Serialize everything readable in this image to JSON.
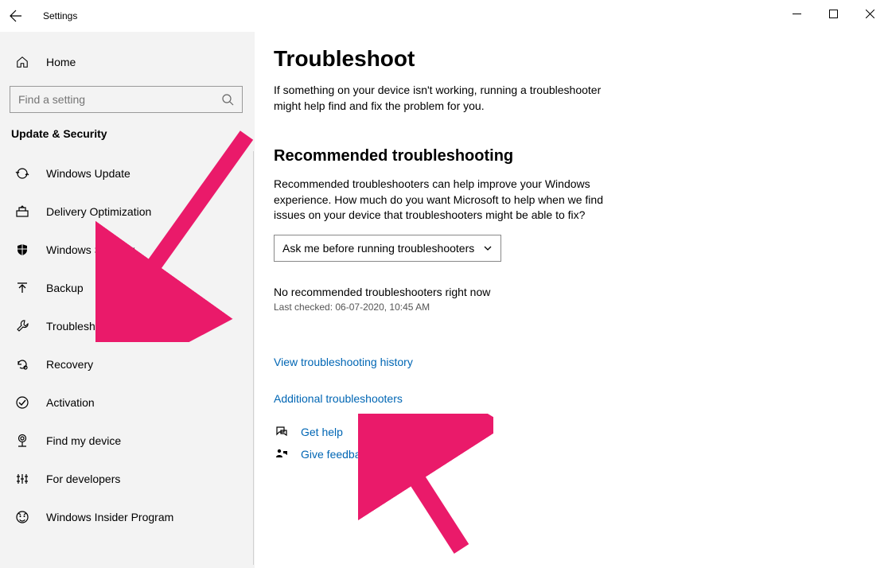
{
  "titlebar": {
    "title": "Settings"
  },
  "sidebar": {
    "home": "Home",
    "search_placeholder": "Find a setting",
    "section": "Update & Security",
    "items": [
      {
        "label": "Windows Update"
      },
      {
        "label": "Delivery Optimization"
      },
      {
        "label": "Windows Security"
      },
      {
        "label": "Backup"
      },
      {
        "label": "Troubleshoot"
      },
      {
        "label": "Recovery"
      },
      {
        "label": "Activation"
      },
      {
        "label": "Find my device"
      },
      {
        "label": "For developers"
      },
      {
        "label": "Windows Insider Program"
      }
    ]
  },
  "main": {
    "heading": "Troubleshoot",
    "intro": "If something on your device isn't working, running a troubleshooter might help find and fix the problem for you.",
    "subheading": "Recommended troubleshooting",
    "desc": "Recommended troubleshooters can help improve your Windows experience. How much do you want Microsoft to help when we find issues on your device that troubleshooters might be able to fix?",
    "dropdown_value": "Ask me before running troubleshooters",
    "status": "No recommended troubleshooters right now",
    "last_checked": "Last checked: 06-07-2020, 10:45 AM",
    "link_history": "View troubleshooting history",
    "link_additional": "Additional troubleshooters",
    "link_help": "Get help",
    "link_feedback": "Give feedback"
  }
}
